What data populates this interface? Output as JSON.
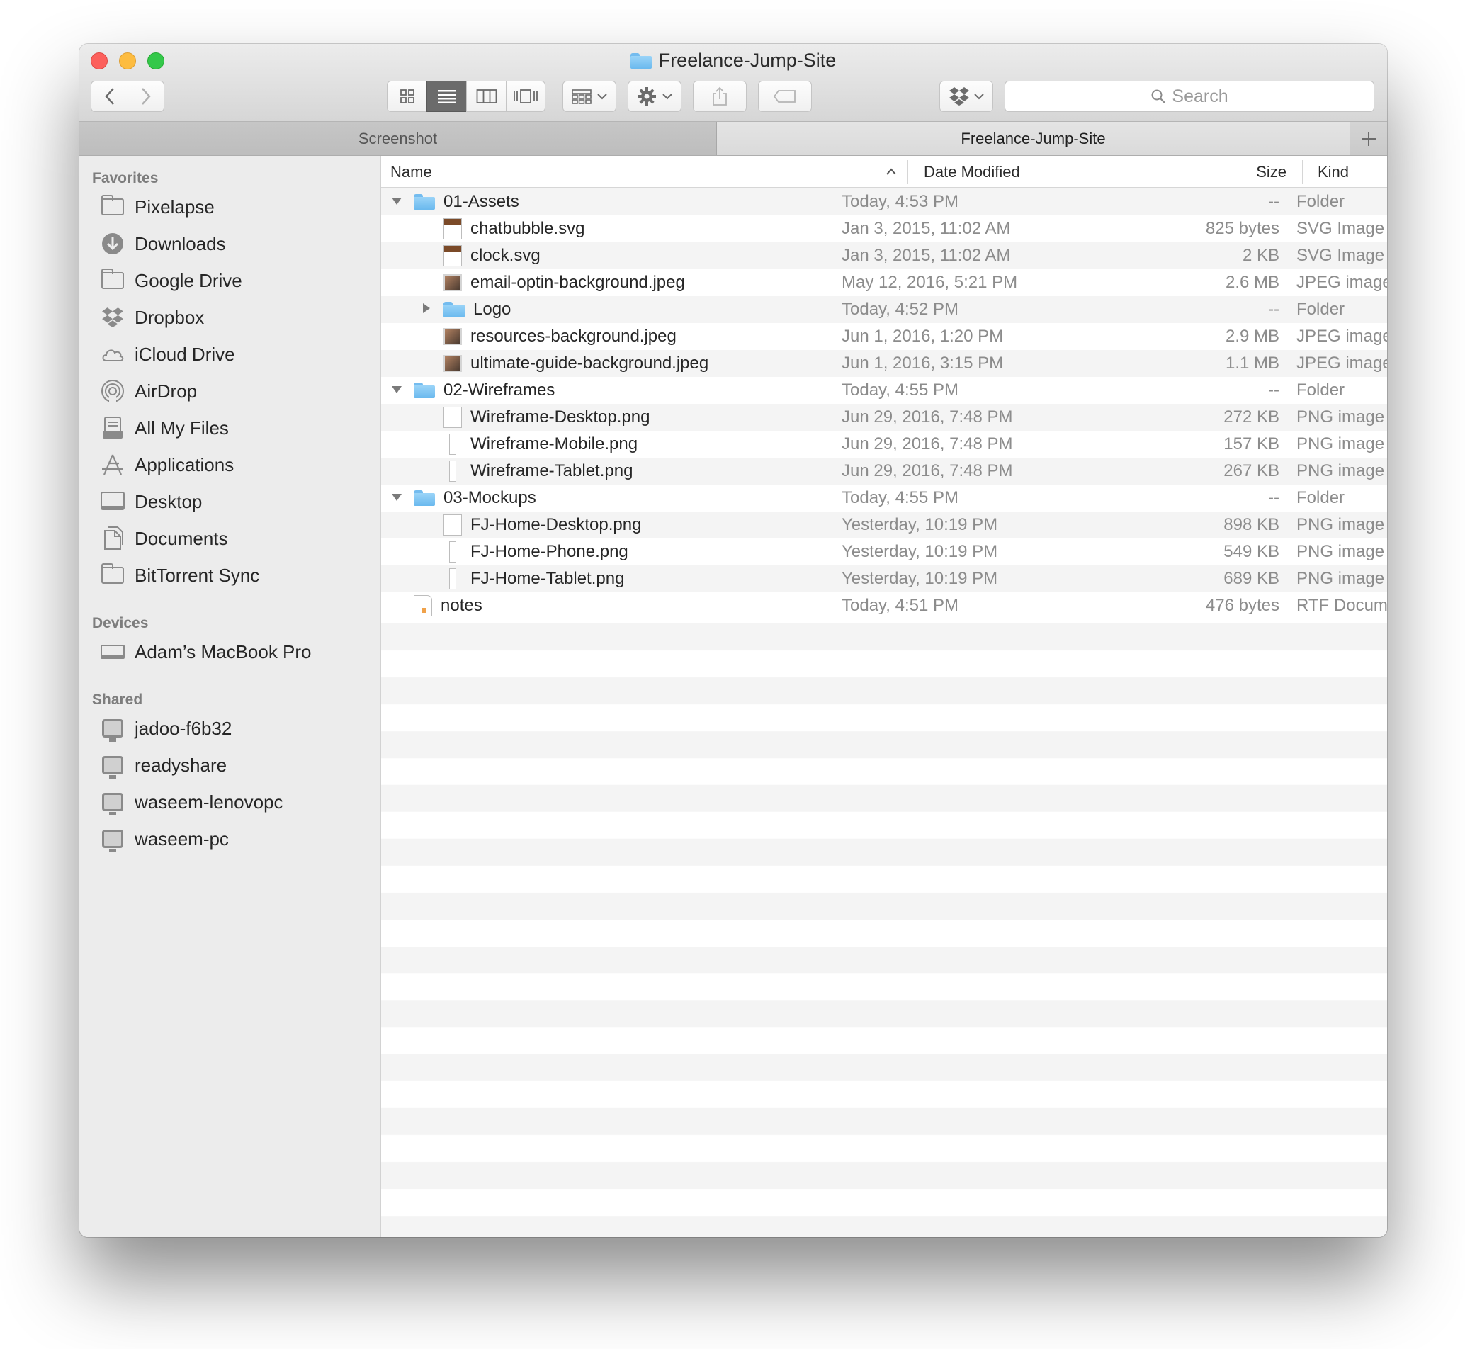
{
  "window": {
    "title": "Freelance-Jump-Site"
  },
  "toolbar": {
    "search_placeholder": "Search"
  },
  "tabs": [
    {
      "label": "Screenshot"
    },
    {
      "label": "Freelance-Jump-Site"
    }
  ],
  "sidebar": {
    "favorites_heading": "Favorites",
    "favorites": [
      {
        "label": "Pixelapse",
        "icon": "folder-icon"
      },
      {
        "label": "Downloads",
        "icon": "downloads-icon"
      },
      {
        "label": "Google Drive",
        "icon": "folder-icon"
      },
      {
        "label": "Dropbox",
        "icon": "dropbox-icon"
      },
      {
        "label": "iCloud Drive",
        "icon": "cloud-icon"
      },
      {
        "label": "AirDrop",
        "icon": "airdrop-icon"
      },
      {
        "label": "All My Files",
        "icon": "all-files-icon"
      },
      {
        "label": "Applications",
        "icon": "applications-icon"
      },
      {
        "label": "Desktop",
        "icon": "desktop-icon"
      },
      {
        "label": "Documents",
        "icon": "documents-icon"
      },
      {
        "label": "BitTorrent Sync",
        "icon": "folder-icon"
      }
    ],
    "devices_heading": "Devices",
    "devices": [
      {
        "label": "Adam’s MacBook Pro",
        "icon": "laptop-icon"
      }
    ],
    "shared_heading": "Shared",
    "shared": [
      {
        "label": "jadoo-f6b32",
        "icon": "monitor-icon"
      },
      {
        "label": "readyshare",
        "icon": "monitor-icon"
      },
      {
        "label": "waseem-lenovopc",
        "icon": "monitor-icon"
      },
      {
        "label": "waseem-pc",
        "icon": "monitor-icon"
      }
    ]
  },
  "list": {
    "columns": {
      "name": "Name",
      "date": "Date Modified",
      "size": "Size",
      "kind": "Kind"
    },
    "rows": [
      {
        "name": "01-Assets",
        "date": "Today, 4:53 PM",
        "size": "--",
        "kind": "Folder",
        "type": "folder",
        "depth": 0,
        "disclosure": "open"
      },
      {
        "name": "chatbubble.svg",
        "date": "Jan 3, 2015, 11:02 AM",
        "size": "825 bytes",
        "kind": "SVG Image",
        "type": "svg",
        "depth": 1
      },
      {
        "name": "clock.svg",
        "date": "Jan 3, 2015, 11:02 AM",
        "size": "2 KB",
        "kind": "SVG Image",
        "type": "svg",
        "depth": 1
      },
      {
        "name": "email-optin-background.jpeg",
        "date": "May 12, 2016, 5:21 PM",
        "size": "2.6 MB",
        "kind": "JPEG image",
        "type": "jpeg",
        "depth": 1
      },
      {
        "name": "Logo",
        "date": "Today, 4:52 PM",
        "size": "--",
        "kind": "Folder",
        "type": "folder",
        "depth": 1,
        "disclosure": "closed"
      },
      {
        "name": "resources-background.jpeg",
        "date": "Jun 1, 2016, 1:20 PM",
        "size": "2.9 MB",
        "kind": "JPEG image",
        "type": "jpeg",
        "depth": 1
      },
      {
        "name": "ultimate-guide-background.jpeg",
        "date": "Jun 1, 2016, 3:15 PM",
        "size": "1.1 MB",
        "kind": "JPEG image",
        "type": "jpeg",
        "depth": 1
      },
      {
        "name": "02-Wireframes",
        "date": "Today, 4:55 PM",
        "size": "--",
        "kind": "Folder",
        "type": "folder",
        "depth": 0,
        "disclosure": "open"
      },
      {
        "name": "Wireframe-Desktop.png",
        "date": "Jun 29, 2016, 7:48 PM",
        "size": "272 KB",
        "kind": "PNG image",
        "type": "png",
        "depth": 1
      },
      {
        "name": "Wireframe-Mobile.png",
        "date": "Jun 29, 2016, 7:48 PM",
        "size": "157 KB",
        "kind": "PNG image",
        "type": "png-thin",
        "depth": 1
      },
      {
        "name": "Wireframe-Tablet.png",
        "date": "Jun 29, 2016, 7:48 PM",
        "size": "267 KB",
        "kind": "PNG image",
        "type": "png-thin",
        "depth": 1
      },
      {
        "name": "03-Mockups",
        "date": "Today, 4:55 PM",
        "size": "--",
        "kind": "Folder",
        "type": "folder",
        "depth": 0,
        "disclosure": "open"
      },
      {
        "name": "FJ-Home-Desktop.png",
        "date": "Yesterday, 10:19 PM",
        "size": "898 KB",
        "kind": "PNG image",
        "type": "png",
        "depth": 1
      },
      {
        "name": "FJ-Home-Phone.png",
        "date": "Yesterday, 10:19 PM",
        "size": "549 KB",
        "kind": "PNG image",
        "type": "png-thin",
        "depth": 1
      },
      {
        "name": "FJ-Home-Tablet.png",
        "date": "Yesterday, 10:19 PM",
        "size": "689 KB",
        "kind": "PNG image",
        "type": "png-thin",
        "depth": 1
      },
      {
        "name": "notes",
        "date": "Today, 4:51 PM",
        "size": "476 bytes",
        "kind": "RTF Document",
        "type": "rtf",
        "depth": 0
      }
    ]
  },
  "colors": {
    "folder_blue": "#6ab9ee",
    "close": "#fc605c",
    "minimize": "#fdbc40",
    "maximize": "#34c84a",
    "sidebar_bg": "#ececec",
    "secondary_text": "#8c8c8c"
  }
}
